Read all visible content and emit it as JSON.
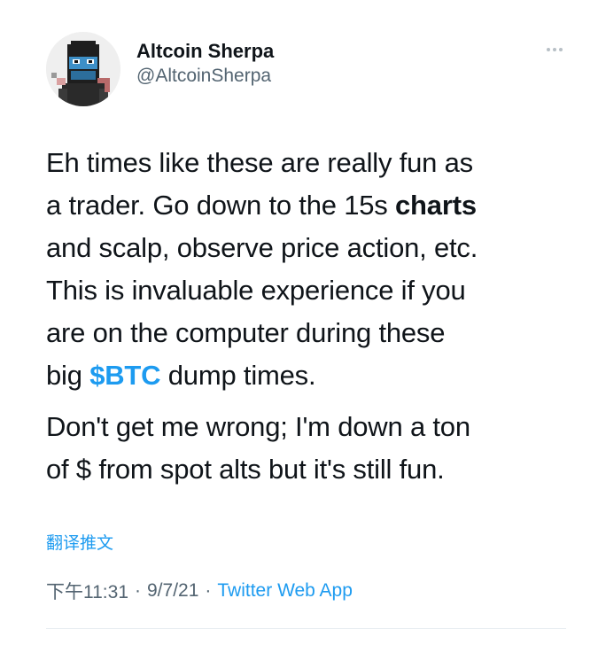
{
  "author": {
    "display_name": "Altcoin Sherpa",
    "handle": "@AltcoinSherpa",
    "avatar_icon": "pixel-art-ninja-avatar-icon"
  },
  "tweet": {
    "p1_a": "Eh times like these are really fun as\na trader. Go down to the 15s ",
    "p1_bold": "charts",
    "p1_b": "\nand scalp, observe price action, etc.\nThis is invaluable experience if you\nare on the computer during these\nbig ",
    "p1_cashtag": "$BTC",
    "p1_c": " dump times.",
    "p2": "Don't get me wrong; I'm down a ton\nof $ from spot alts but it's still fun."
  },
  "translate_label": "翻译推文",
  "meta": {
    "time": "下午11:31",
    "date": "9/7/21",
    "separator": "·",
    "source": "Twitter Web App"
  },
  "colors": {
    "accent": "#1d9bf0",
    "text": "#0f1419",
    "secondary": "#536471"
  }
}
